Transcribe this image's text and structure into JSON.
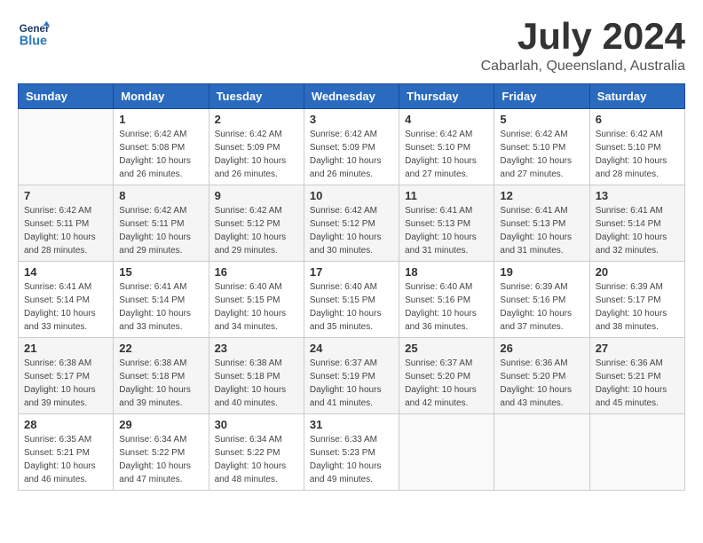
{
  "header": {
    "logo_general": "General",
    "logo_blue": "Blue",
    "month_year": "July 2024",
    "location": "Cabarlah, Queensland, Australia"
  },
  "weekdays": [
    "Sunday",
    "Monday",
    "Tuesday",
    "Wednesday",
    "Thursday",
    "Friday",
    "Saturday"
  ],
  "weeks": [
    [
      {
        "day": "",
        "sunrise": "",
        "sunset": "",
        "daylight": ""
      },
      {
        "day": "1",
        "sunrise": "6:42 AM",
        "sunset": "5:08 PM",
        "daylight": "10 hours and 26 minutes."
      },
      {
        "day": "2",
        "sunrise": "6:42 AM",
        "sunset": "5:09 PM",
        "daylight": "10 hours and 26 minutes."
      },
      {
        "day": "3",
        "sunrise": "6:42 AM",
        "sunset": "5:09 PM",
        "daylight": "10 hours and 26 minutes."
      },
      {
        "day": "4",
        "sunrise": "6:42 AM",
        "sunset": "5:10 PM",
        "daylight": "10 hours and 27 minutes."
      },
      {
        "day": "5",
        "sunrise": "6:42 AM",
        "sunset": "5:10 PM",
        "daylight": "10 hours and 27 minutes."
      },
      {
        "day": "6",
        "sunrise": "6:42 AM",
        "sunset": "5:10 PM",
        "daylight": "10 hours and 28 minutes."
      }
    ],
    [
      {
        "day": "7",
        "sunrise": "6:42 AM",
        "sunset": "5:11 PM",
        "daylight": "10 hours and 28 minutes."
      },
      {
        "day": "8",
        "sunrise": "6:42 AM",
        "sunset": "5:11 PM",
        "daylight": "10 hours and 29 minutes."
      },
      {
        "day": "9",
        "sunrise": "6:42 AM",
        "sunset": "5:12 PM",
        "daylight": "10 hours and 29 minutes."
      },
      {
        "day": "10",
        "sunrise": "6:42 AM",
        "sunset": "5:12 PM",
        "daylight": "10 hours and 30 minutes."
      },
      {
        "day": "11",
        "sunrise": "6:41 AM",
        "sunset": "5:13 PM",
        "daylight": "10 hours and 31 minutes."
      },
      {
        "day": "12",
        "sunrise": "6:41 AM",
        "sunset": "5:13 PM",
        "daylight": "10 hours and 31 minutes."
      },
      {
        "day": "13",
        "sunrise": "6:41 AM",
        "sunset": "5:14 PM",
        "daylight": "10 hours and 32 minutes."
      }
    ],
    [
      {
        "day": "14",
        "sunrise": "6:41 AM",
        "sunset": "5:14 PM",
        "daylight": "10 hours and 33 minutes."
      },
      {
        "day": "15",
        "sunrise": "6:41 AM",
        "sunset": "5:14 PM",
        "daylight": "10 hours and 33 minutes."
      },
      {
        "day": "16",
        "sunrise": "6:40 AM",
        "sunset": "5:15 PM",
        "daylight": "10 hours and 34 minutes."
      },
      {
        "day": "17",
        "sunrise": "6:40 AM",
        "sunset": "5:15 PM",
        "daylight": "10 hours and 35 minutes."
      },
      {
        "day": "18",
        "sunrise": "6:40 AM",
        "sunset": "5:16 PM",
        "daylight": "10 hours and 36 minutes."
      },
      {
        "day": "19",
        "sunrise": "6:39 AM",
        "sunset": "5:16 PM",
        "daylight": "10 hours and 37 minutes."
      },
      {
        "day": "20",
        "sunrise": "6:39 AM",
        "sunset": "5:17 PM",
        "daylight": "10 hours and 38 minutes."
      }
    ],
    [
      {
        "day": "21",
        "sunrise": "6:38 AM",
        "sunset": "5:17 PM",
        "daylight": "10 hours and 39 minutes."
      },
      {
        "day": "22",
        "sunrise": "6:38 AM",
        "sunset": "5:18 PM",
        "daylight": "10 hours and 39 minutes."
      },
      {
        "day": "23",
        "sunrise": "6:38 AM",
        "sunset": "5:18 PM",
        "daylight": "10 hours and 40 minutes."
      },
      {
        "day": "24",
        "sunrise": "6:37 AM",
        "sunset": "5:19 PM",
        "daylight": "10 hours and 41 minutes."
      },
      {
        "day": "25",
        "sunrise": "6:37 AM",
        "sunset": "5:20 PM",
        "daylight": "10 hours and 42 minutes."
      },
      {
        "day": "26",
        "sunrise": "6:36 AM",
        "sunset": "5:20 PM",
        "daylight": "10 hours and 43 minutes."
      },
      {
        "day": "27",
        "sunrise": "6:36 AM",
        "sunset": "5:21 PM",
        "daylight": "10 hours and 45 minutes."
      }
    ],
    [
      {
        "day": "28",
        "sunrise": "6:35 AM",
        "sunset": "5:21 PM",
        "daylight": "10 hours and 46 minutes."
      },
      {
        "day": "29",
        "sunrise": "6:34 AM",
        "sunset": "5:22 PM",
        "daylight": "10 hours and 47 minutes."
      },
      {
        "day": "30",
        "sunrise": "6:34 AM",
        "sunset": "5:22 PM",
        "daylight": "10 hours and 48 minutes."
      },
      {
        "day": "31",
        "sunrise": "6:33 AM",
        "sunset": "5:23 PM",
        "daylight": "10 hours and 49 minutes."
      },
      {
        "day": "",
        "sunrise": "",
        "sunset": "",
        "daylight": ""
      },
      {
        "day": "",
        "sunrise": "",
        "sunset": "",
        "daylight": ""
      },
      {
        "day": "",
        "sunrise": "",
        "sunset": "",
        "daylight": ""
      }
    ]
  ],
  "labels": {
    "sunrise_prefix": "Sunrise: ",
    "sunset_prefix": "Sunset: ",
    "daylight_label": "Daylight: "
  }
}
